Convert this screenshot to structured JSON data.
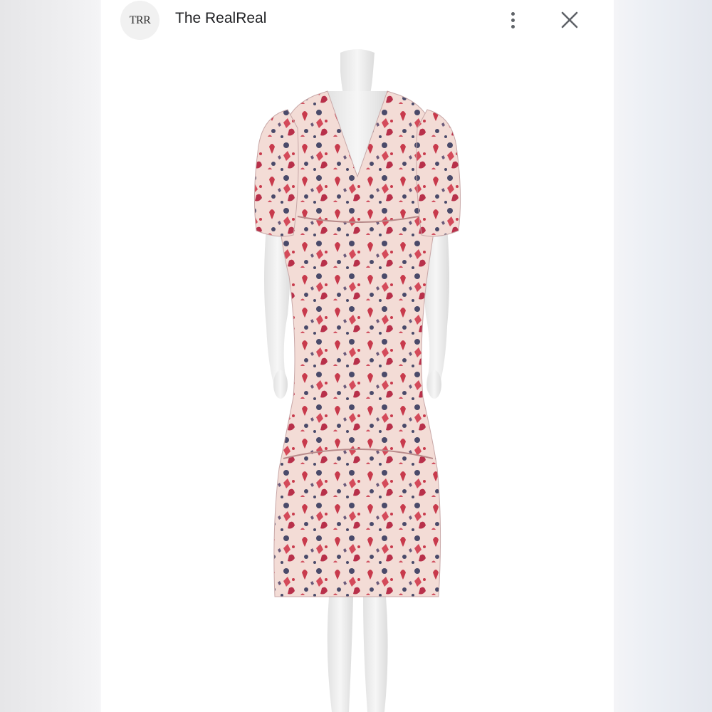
{
  "header": {
    "logo_text": "TRR",
    "site_name": "The RealReal",
    "more_icon": "more-vert-icon",
    "close_icon": "close-icon"
  },
  "product": {
    "image_subject": "floral print midi dress with puff sleeves on mannequin",
    "colors": {
      "fabric_base": "#f3dcd6",
      "print_red": "#c83a4c",
      "print_navy": "#4a4a6a",
      "mannequin": "#eeeeee"
    }
  }
}
